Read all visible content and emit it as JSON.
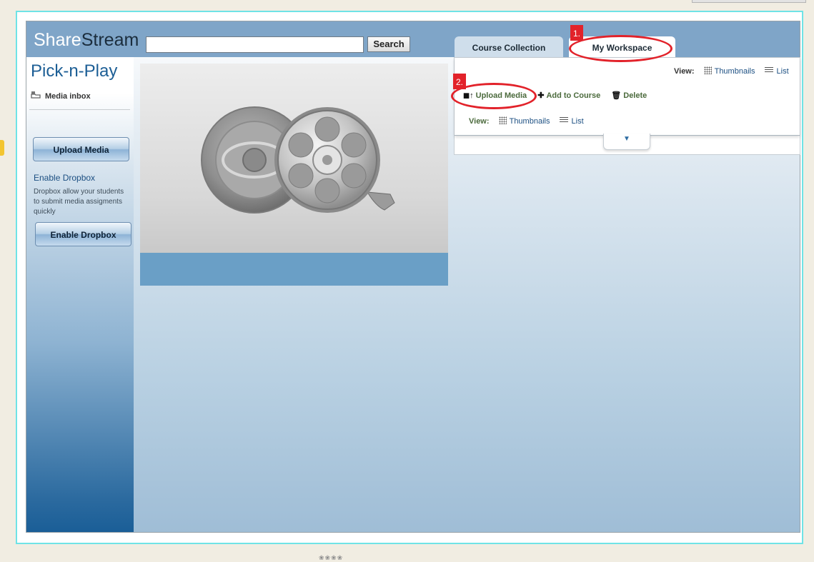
{
  "header": {
    "brand_part1": "Share",
    "brand_part2": "Stream",
    "search_value": "",
    "search_button": "Search"
  },
  "tabs": [
    {
      "label": "Course Collection",
      "active": false
    },
    {
      "label": "My Workspace",
      "active": true
    }
  ],
  "sidebar": {
    "title": "Pick-n-Play",
    "inbox_label": "Media inbox",
    "upload_button": "Upload Media",
    "dropbox_link": "Enable Dropbox",
    "dropbox_description": "Dropbox allow your students to submit media assigments quickly",
    "dropbox_button": "Enable Dropbox"
  },
  "panel": {
    "view_label": "View:",
    "view_thumbnails": "Thumbnails",
    "view_list": "List",
    "actions": {
      "upload": "Upload Media",
      "add_to_course": "Add to Course",
      "delete": "Delete"
    },
    "view2_label": "View:",
    "view2_thumbnails": "Thumbnails",
    "view2_list": "List"
  },
  "annotations": {
    "step1": "1.",
    "step2": "2."
  },
  "colors": {
    "highlight": "#e2222a",
    "frame_border": "#6fe3e6",
    "header_bar": "#7fa5c8",
    "title_blue": "#1c5e95"
  },
  "icons": [
    "media-inbox-icon",
    "upload-icon",
    "add-icon",
    "trash-icon",
    "thumbnails-grid-icon",
    "list-icon",
    "chevron-down-icon",
    "speaker-icon",
    "film-reel-icon"
  ]
}
